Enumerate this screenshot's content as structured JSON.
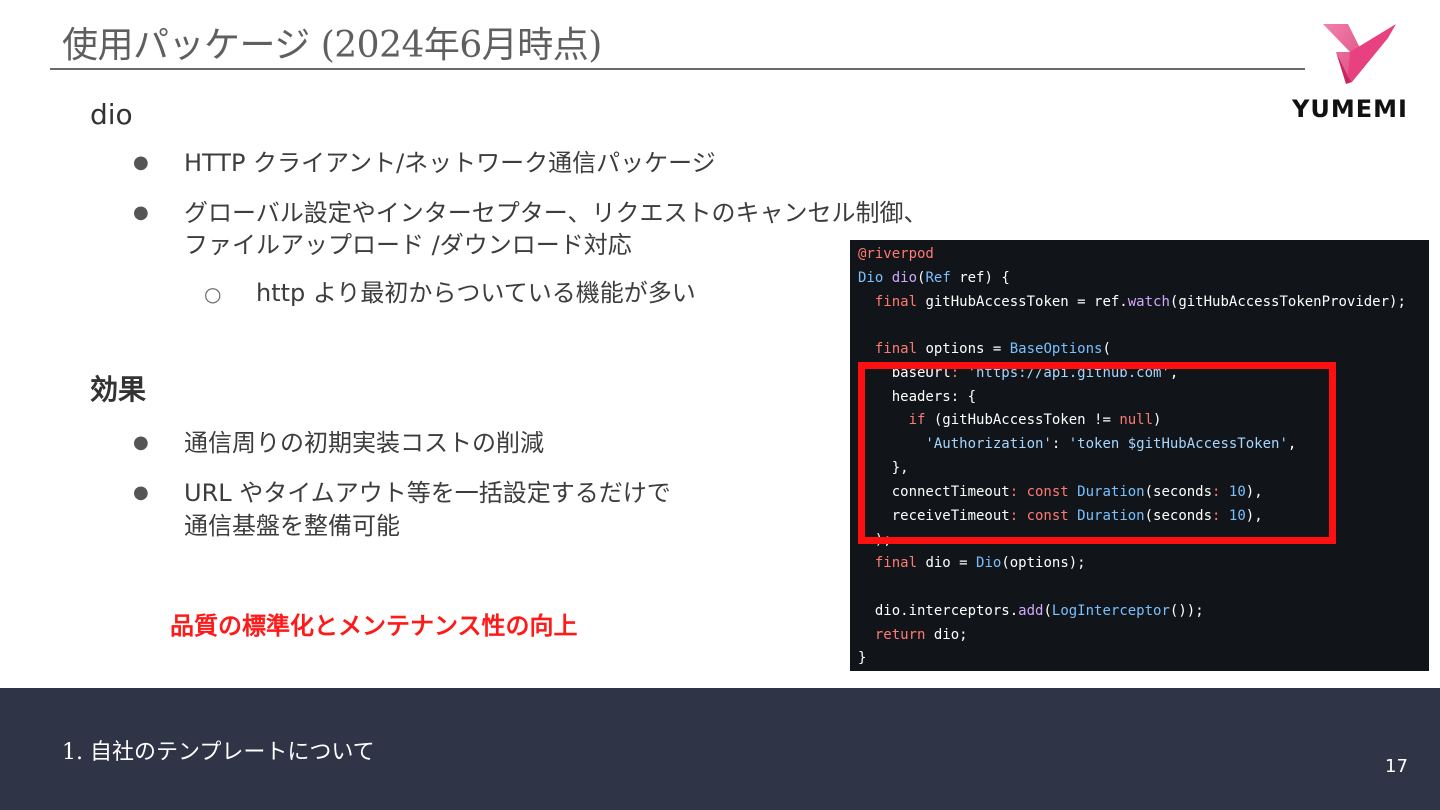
{
  "slide": {
    "title": "使用パッケージ (2024年6月時点)",
    "logo_text": "YUMEMI",
    "colors": {
      "accent_red": "#ff1a1a",
      "footer_bg": "#2f3447",
      "logo_pink": "#e8417f"
    }
  },
  "section_dio": {
    "heading": "dio",
    "bullets": [
      "HTTP クライアント/ネットワーク通信パッケージ",
      "グローバル設定やインターセプター、リクエストのキャンセル制御、",
      "ファイルアップロード /ダウンロード対応"
    ],
    "sub_bullet": "http より最初からついている機能が多い"
  },
  "section_effect": {
    "heading": "効果",
    "bullets": [
      "通信周りの初期実装コストの削減",
      "URL やタイムアウト等を一括設定するだけで",
      "通信基盤を整備可能"
    ],
    "highlight": "品質の標準化とメンテナンス性の向上"
  },
  "code": {
    "l1": "@riverpod",
    "l2a": "Dio",
    "l2b": " ",
    "l2c": "dio",
    "l2d": "(",
    "l2e": "Ref",
    "l2f": " ref) {",
    "l3a": "  final",
    "l3b": " gitHubAccessToken = ref.",
    "l3c": "watch",
    "l3d": "(gitHubAccessTokenProvider);",
    "l4a": "  final",
    "l4b": " options = ",
    "l4c": "BaseOptions",
    "l4d": "(",
    "l5a": "    baseUrl",
    "l5b": ": ",
    "l5c": "'https://api.github.com'",
    "l5d": ",",
    "l6a": "    headers",
    "l6b": ": {",
    "l7a": "      if",
    "l7b": " (gitHubAccessToken != ",
    "l7c": "null",
    "l7d": ")",
    "l8a": "        'Authorization'",
    "l8b": ": ",
    "l8c": "'token $gitHubAccessToken'",
    "l8d": ",",
    "l9": "    },",
    "l10a": "    connectTimeout",
    "l10b": ": ",
    "l10c": "const",
    "l10d": " ",
    "l10e": "Duration",
    "l10f": "(seconds",
    "l10g": ": ",
    "l10h": "10",
    "l10i": "),",
    "l11a": "    receiveTimeout",
    "l11b": ": ",
    "l11c": "const",
    "l11d": " ",
    "l11e": "Duration",
    "l11f": "(seconds",
    "l11g": ": ",
    "l11h": "10",
    "l11i": "),",
    "l12": "  );",
    "l13a": "  final",
    "l13b": " dio = ",
    "l13c": "Dio",
    "l13d": "(options);",
    "l14a": "  dio.interceptors.",
    "l14b": "add",
    "l14c": "(",
    "l14d": "LogInterceptor",
    "l14e": "());",
    "l15a": "  return",
    "l15b": " dio;",
    "l16": "}"
  },
  "footer": {
    "section": "1.  自社のテンプレートについて",
    "page_number": "17"
  }
}
